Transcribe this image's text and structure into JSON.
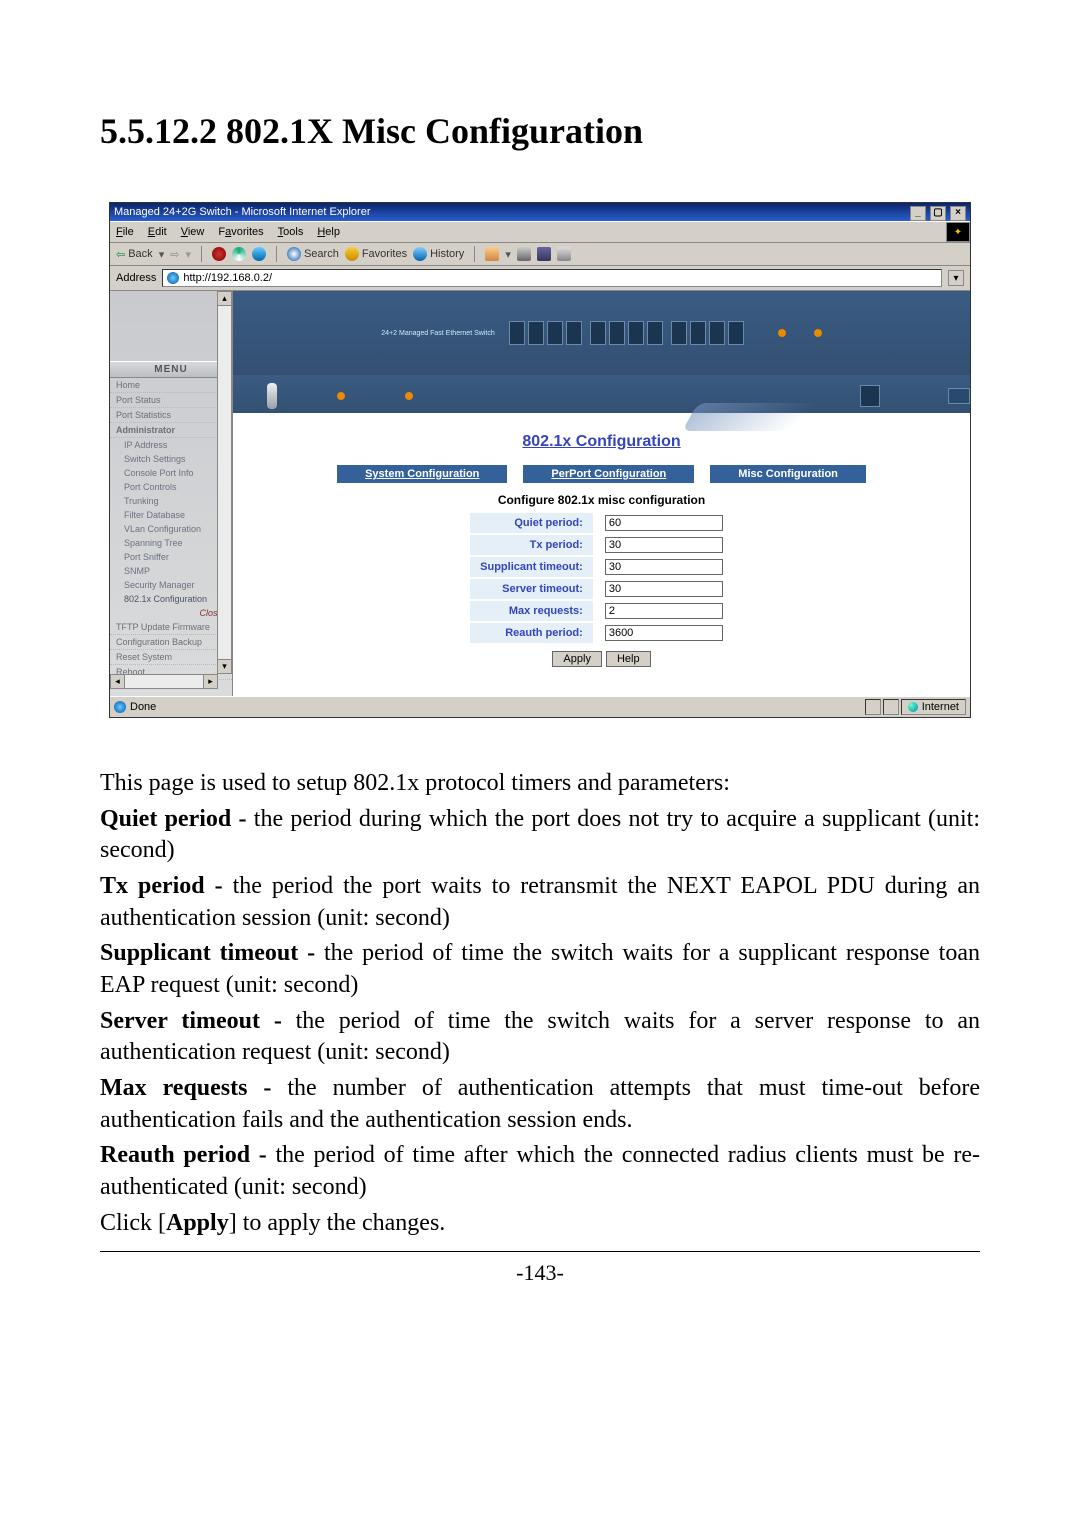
{
  "page": {
    "heading": "5.5.12.2 802.1X Misc Configuration",
    "number": "-143-"
  },
  "browser": {
    "title": "Managed 24+2G Switch - Microsoft Internet Explorer",
    "menus": [
      "File",
      "Edit",
      "View",
      "Favorites",
      "Tools",
      "Help"
    ],
    "toolbar": {
      "back": "Back",
      "search": "Search",
      "favorites": "Favorites",
      "history": "History"
    },
    "address_label": "Address",
    "url": "http://192.168.0.2/",
    "status_left": "Done",
    "status_right": "Internet"
  },
  "sidebar": {
    "title": "MENU",
    "items": [
      {
        "label": "Home"
      },
      {
        "label": "Port Status"
      },
      {
        "label": "Port Statistics"
      },
      {
        "label": "Administrator",
        "subs": [
          {
            "label": "IP Address"
          },
          {
            "label": "Switch Settings"
          },
          {
            "label": "Console Port Info"
          },
          {
            "label": "Port Controls"
          },
          {
            "label": "Trunking"
          },
          {
            "label": "Filter Database"
          },
          {
            "label": "VLan Configuration"
          },
          {
            "label": "Spanning Tree"
          },
          {
            "label": "Port Sniffer"
          },
          {
            "label": "SNMP"
          },
          {
            "label": "Security Manager"
          },
          {
            "label": "802.1x Configuration"
          }
        ],
        "close": "Close*"
      },
      {
        "label": "TFTP Update Firmware"
      },
      {
        "label": "Configuration Backup"
      },
      {
        "label": "Reset System"
      },
      {
        "label": "Reboot"
      }
    ]
  },
  "config": {
    "title": "802.1x Configuration",
    "tabs": [
      "System Configuration",
      "PerPort Configuration",
      "Misc Configuration"
    ],
    "subtitle": "Configure 802.1x misc configuration",
    "fields": {
      "quiet_label": "Quiet period:",
      "quiet": "60",
      "tx_label": "Tx period:",
      "tx": "30",
      "supp_label": "Supplicant timeout:",
      "supp": "30",
      "serv_label": "Server timeout:",
      "serv": "30",
      "maxreq_label": "Max requests:",
      "maxreq": "2",
      "reauth_label": "Reauth period:",
      "reauth": "3600"
    },
    "buttons": {
      "apply": "Apply",
      "help": "Help"
    }
  },
  "desc": {
    "p1": "This page is used to setup 802.1x protocol timers and parameters:",
    "q_b": "Quiet period  - ",
    "q_t": "the period during which the port does not try to acquire a supplicant (unit: second)",
    "tx_b": "Tx period - ",
    "tx_t": "the period the port waits to retransmit the NEXT EAPOL PDU during an authentication session (unit: second)",
    "su_b": "Supplicant timeout - ",
    "su_t": "the period of time the switch waits for a supplicant response toan EAP request (unit: second)",
    "se_b": "Server timeout - ",
    "se_t": "the period of time the switch waits for a server response to an authentication request (unit: second)",
    "mr_b": "Max requests - ",
    "mr_t": "the number of authentication attempts that must time-out before authentication fails and the authentication session ends.",
    "ra_b": "Reauth period - ",
    "ra_t": "the period of time after which the connected radius clients must be re-authenticated (unit: second)",
    "click_a": "Click [",
    "click_b": "Apply",
    "click_c": "] to apply the changes."
  }
}
